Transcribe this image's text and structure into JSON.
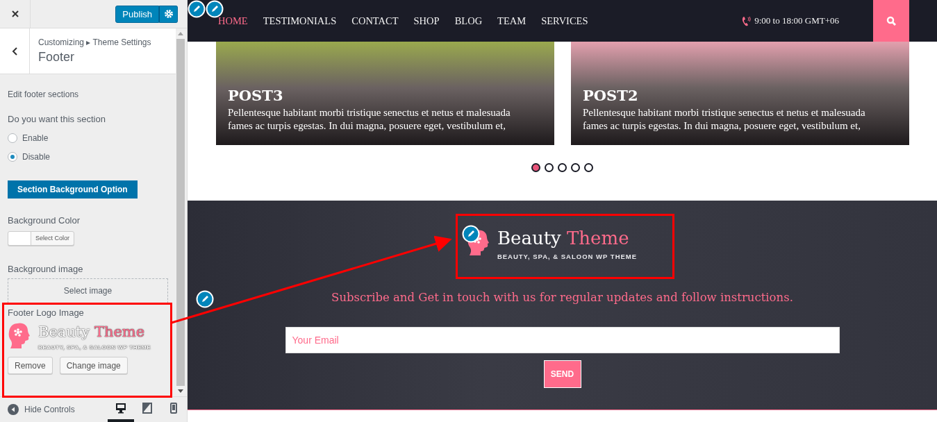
{
  "customizer": {
    "publish_button": "Publish",
    "breadcrumb": "Customizing ▸ Theme Settings",
    "title": "Footer",
    "description": "Edit footer sections",
    "question": "Do you want this section",
    "options": [
      {
        "label": "Enable",
        "selected": false
      },
      {
        "label": "Disable",
        "selected": true
      }
    ],
    "background_option_button": "Section Background Option",
    "background_color_label": "Background Color",
    "select_color_button": "Select Color",
    "background_image_label": "Background image",
    "select_image_button": "Select image",
    "footer_logo_label": "Footer Logo Image",
    "logo_preview": {
      "name": "Beauty",
      "name_accent": "Theme",
      "tagline": "BEAUTY, SPA, & SALOON WP THEME"
    },
    "remove_button": "Remove",
    "change_image_button": "Change image",
    "hide_controls": "Hide Controls",
    "devices": [
      {
        "kind": "desktop",
        "selected": true
      },
      {
        "kind": "tablet",
        "selected": false
      },
      {
        "kind": "mobile",
        "selected": false
      }
    ]
  },
  "preview": {
    "nav": [
      {
        "label": "HOME",
        "selected": true
      },
      {
        "label": "TESTIMONIALS",
        "selected": false
      },
      {
        "label": "CONTACT",
        "selected": false
      },
      {
        "label": "SHOP",
        "selected": false
      },
      {
        "label": "BLOG",
        "selected": false
      },
      {
        "label": "TEAM",
        "selected": false
      },
      {
        "label": "SERVICES",
        "selected": false
      }
    ],
    "hours": "9:00 to 18:00 GMT+06",
    "posts": [
      {
        "title": "POST3",
        "excerpt": "Pellentesque habitant morbi tristique senectus et netus et malesuada fames ac turpis egestas. In dui magna, posuere eget, vestibulum et,",
        "color": "#9aa94e"
      },
      {
        "title": "POST2",
        "excerpt": "Pellentesque habitant morbi tristique senectus et netus et malesuada fames ac turpis egestas. In dui magna, posuere eget, vestibulum et,",
        "color": "#e3a0ae"
      }
    ],
    "slider_dots": [
      {
        "selected": true
      },
      {
        "selected": false
      },
      {
        "selected": false
      },
      {
        "selected": false
      },
      {
        "selected": false
      }
    ],
    "footer": {
      "logo": {
        "name": "Beauty",
        "name_accent": "Theme",
        "tagline": "BEAUTY, SPA, & SALOON WP THEME"
      },
      "subscribe_text": "Subscribe and Get in touch with us for regular updates and follow instructions.",
      "email_placeholder": "Your Email",
      "send_button": "SEND"
    }
  }
}
